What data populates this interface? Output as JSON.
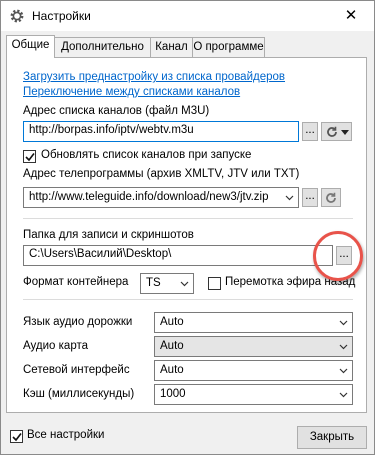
{
  "window": {
    "title": "Настройки",
    "close_glyph": "✕",
    "app_icon": "gear-icon"
  },
  "tabs": [
    {
      "label": "Общие",
      "active": true
    },
    {
      "label": "Дополнительно",
      "active": false
    },
    {
      "label": "Канал",
      "active": false
    },
    {
      "label": "О программе",
      "active": false
    }
  ],
  "links": {
    "load_preset": "Загрузить преднастройку из списка провайдеров",
    "switch_lists": "Переключение между списками каналов"
  },
  "channel_list": {
    "label": "Адрес списка каналов (файл M3U)",
    "value": "http://borpas.info/iptv/webtv.m3u",
    "browse": "..."
  },
  "update_on_start": {
    "label": "Обновлять список каналов при запуске",
    "checked": true
  },
  "tv_program": {
    "label": "Адрес телепрограммы (архив XMLTV, JTV или TXT)",
    "value": "http://www.teleguide.info/download/new3/jtv.zip",
    "browse": "..."
  },
  "record_folder": {
    "label": "Папка для записи и скриншотов",
    "value": "C:\\Users\\Василий\\Desktop\\",
    "browse": "..."
  },
  "container": {
    "label": "Формат контейнера",
    "value": "TS"
  },
  "timeshift": {
    "label": "Перемотка эфира назад",
    "checked": false
  },
  "audio_track": {
    "label": "Язык аудио дорожки",
    "value": "Auto"
  },
  "audio_card": {
    "label": "Аудио карта",
    "value": "Auto"
  },
  "net_interface": {
    "label": "Сетевой интерфейс",
    "value": "Auto"
  },
  "cache": {
    "label": "Кэш (миллисекунды)",
    "value": "1000"
  },
  "footer": {
    "all_settings": {
      "label": "Все настройки",
      "checked": true
    },
    "close_button": "Закрыть"
  },
  "colors": {
    "link": "#0066cc",
    "highlight_circle": "#e8534a",
    "focus_border": "#0078d7"
  }
}
